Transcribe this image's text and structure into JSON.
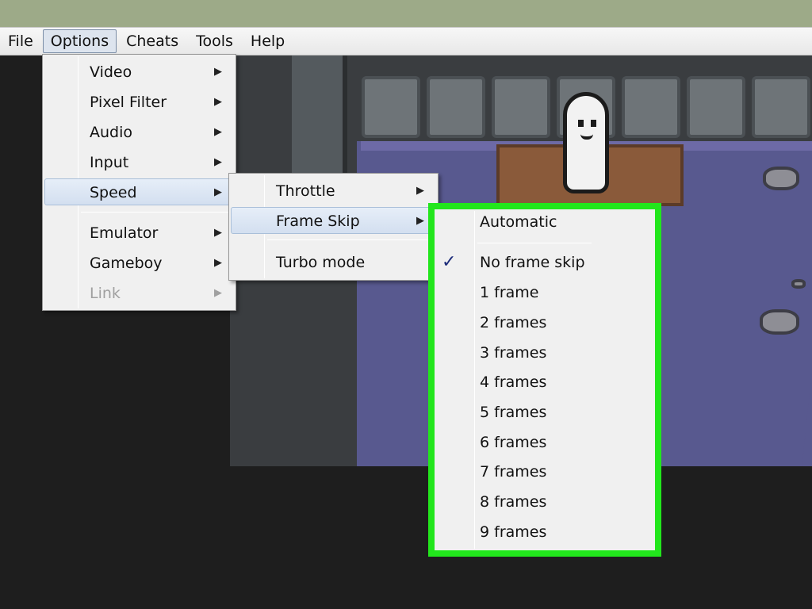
{
  "menubar": {
    "items": [
      "File",
      "Options",
      "Cheats",
      "Tools",
      "Help"
    ],
    "open_item": "Options"
  },
  "options_menu": {
    "items": [
      {
        "label": "Video",
        "submenu": true
      },
      {
        "label": "Pixel Filter",
        "submenu": true
      },
      {
        "label": "Audio",
        "submenu": true
      },
      {
        "label": "Input",
        "submenu": true
      },
      {
        "label": "Speed",
        "submenu": true,
        "highlighted": true
      },
      {
        "label": "Emulator",
        "submenu": true
      },
      {
        "label": "Gameboy",
        "submenu": true
      },
      {
        "label": "Link",
        "submenu": true,
        "disabled": true
      }
    ]
  },
  "speed_menu": {
    "items": [
      {
        "label": "Throttle",
        "submenu": true
      },
      {
        "label": "Frame Skip",
        "submenu": true,
        "highlighted": true
      },
      {
        "label": "Turbo mode",
        "submenu": false
      }
    ]
  },
  "frameskip_menu": {
    "items": [
      {
        "label": "Automatic"
      },
      {
        "label": "No frame skip",
        "checked": true
      },
      {
        "label": "1 frame"
      },
      {
        "label": "2 frames"
      },
      {
        "label": "3 frames"
      },
      {
        "label": "4 frames"
      },
      {
        "label": "5 frames"
      },
      {
        "label": "6 frames"
      },
      {
        "label": "7 frames"
      },
      {
        "label": "8 frames"
      },
      {
        "label": "9 frames"
      }
    ],
    "check_glyph": "✓",
    "highlight_color": "#22e61c"
  },
  "arrow_glyph": "▶",
  "colors": {
    "menubar_bg": "#efefef",
    "menu_bg": "#f0f0f0",
    "game_floor": "#58598f",
    "callout_border": "#22e61c"
  }
}
